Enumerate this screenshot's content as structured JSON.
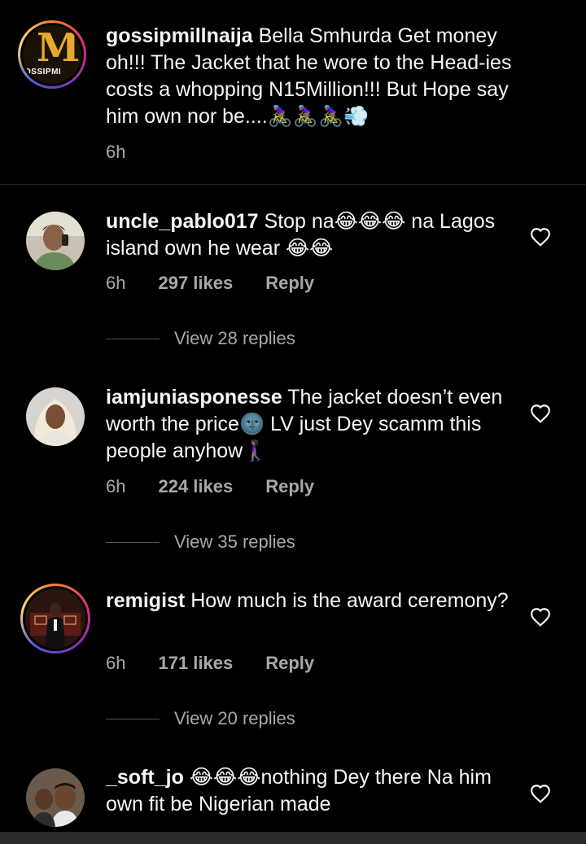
{
  "caption": {
    "username": "gossipmillnaija",
    "text": "Bella Smhurda Get money oh!!! The Jacket that he wore to the Head-ies costs a whopping N15Million!!! But Hope say him own nor be....🚴🏾‍♀️🚴🏾‍♀️🚴🏾‍♀️💨",
    "time": "6h",
    "logo_letter": "M",
    "logo_text": "OSSIPMI"
  },
  "comments": [
    {
      "username": "uncle_pablo017",
      "text": "Stop na😂😂😂 na Lagos island own he wear 😂😂",
      "time": "6h",
      "likes": "297 likes",
      "reply": "Reply",
      "view_replies": "View 28 replies"
    },
    {
      "username": "iamjuniasponesse",
      "text": "The jacket doesn’t even worth the price🌚 LV just Dey scamm this people anyhow🚶🏾‍♀️",
      "time": "6h",
      "likes": "224 likes",
      "reply": "Reply",
      "view_replies": "View 35 replies"
    },
    {
      "username": "remigist",
      "text": "How much is the award ceremony?",
      "time": "6h",
      "likes": "171 likes",
      "reply": "Reply",
      "view_replies": "View 20 replies"
    },
    {
      "username": "_soft_jo",
      "text": "😂😂😂nothing Dey there Na him own fit be Nigerian made"
    }
  ],
  "colors": {
    "background": "#000000",
    "text": "#f5f5f5",
    "muted": "#a8a8a8",
    "story_ring": "#dd2a7b"
  },
  "icons": {
    "like": "heart-outline-icon"
  }
}
